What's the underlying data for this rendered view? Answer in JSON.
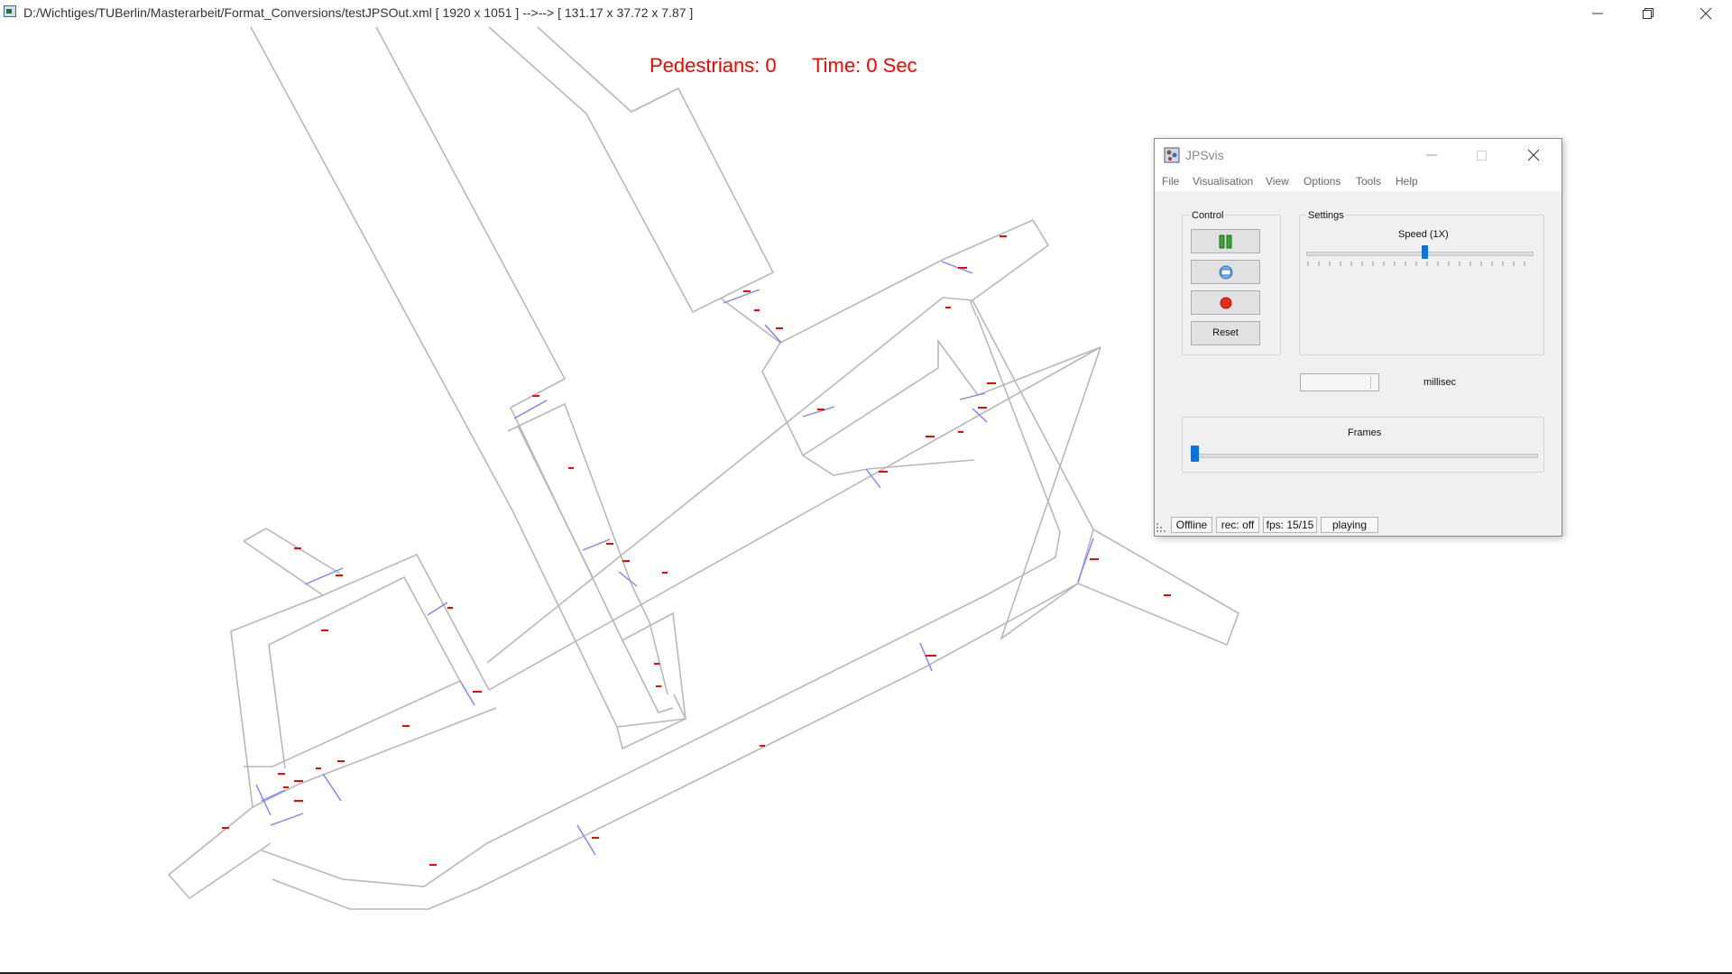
{
  "window": {
    "title": "D:/Wichtiges/TUBerlin/Masterarbeit/Format_Conversions/testJPSOut.xml [ 1920 x 1051 ] -->--> [ 131.17 x 37.72 x 7.87 ]"
  },
  "overlay": {
    "pedestrians": "Pedestrians: 0",
    "time": "Time: 0 Sec",
    "color": "#ff0000"
  },
  "geometry": {
    "wall_color": "#b8b8b8",
    "transition_color": "#8080ff",
    "label_color": "#ff0000"
  },
  "dialog": {
    "title": "JPSvis",
    "menu": [
      "File",
      "Visualisation",
      "View",
      "Options",
      "Tools",
      "Help"
    ],
    "control": {
      "label": "Control",
      "reset_label": "Reset",
      "icons": [
        "pause-icon",
        "camera-icon",
        "record-icon"
      ]
    },
    "settings": {
      "label": "Settings",
      "speed_label": "Speed (1X)",
      "speed_position": 0.52
    },
    "spinbox": {
      "value": "",
      "unit": "millisec"
    },
    "frames": {
      "label": "Frames",
      "position": 0.0
    },
    "status": {
      "network": "Offline",
      "recording": "rec: off",
      "fps": "fps: 15/15",
      "state": "playing"
    },
    "accent_color": "#0a74da"
  }
}
